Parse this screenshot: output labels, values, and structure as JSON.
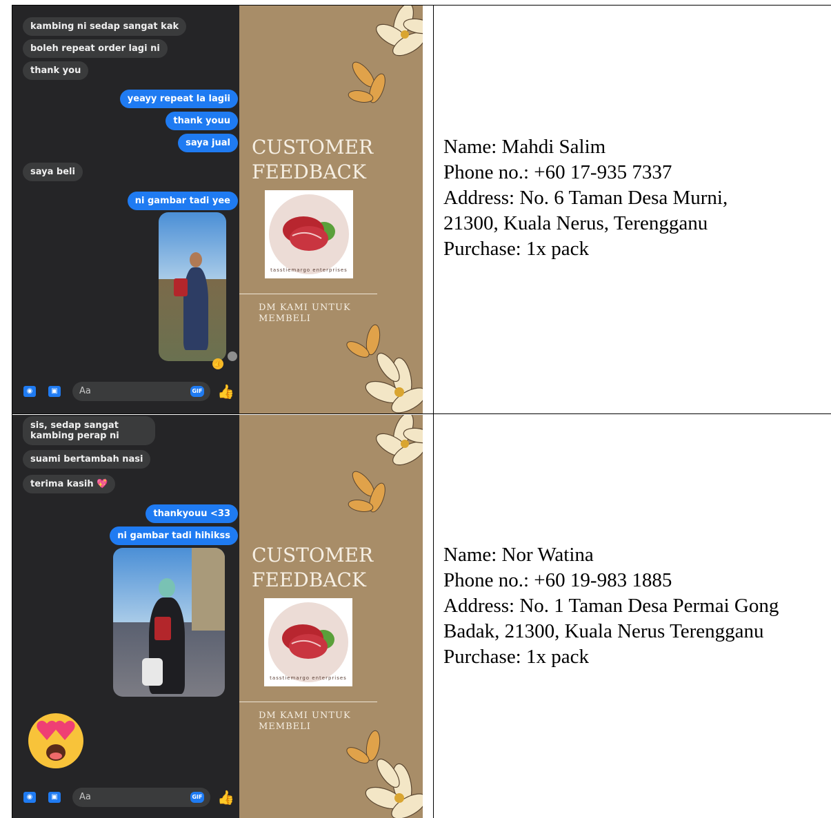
{
  "rows": [
    {
      "chat": {
        "incoming_1": "kambing ni sedap sangat kak",
        "incoming_2": "boleh repeat order lagi ni",
        "incoming_3": "thank you",
        "outgoing_1": "yeayy repeat la lagii",
        "outgoing_2": "thank youu",
        "outgoing_3": "saya jual",
        "incoming_4": "saya beli",
        "outgoing_4": "ni gambar tadi yee",
        "composer_placeholder": "Aa",
        "gif_label": "GIF"
      },
      "poster": {
        "title_line1": "CUSTOMER",
        "title_line2": "FEEDBACK",
        "logo_text": "tasstiemargo enterprises",
        "cta_line1": "DM KAMI UNTUK",
        "cta_line2": "MEMBELI"
      },
      "details": {
        "name": "Name: Mahdi Salim",
        "phone": "Phone no.: +60 17-935 7337",
        "address_line1": "Address: No. 6 Taman Desa Murni,",
        "address_line2": "21300, Kuala Nerus, Terengganu",
        "purchase": "Purchase: 1x pack"
      }
    },
    {
      "chat": {
        "incoming_1": "sis, sedap sangat kambing perap ni",
        "incoming_2": "suami bertambah nasi",
        "incoming_3": "terima kasih 💖",
        "outgoing_1": "thankyouu <33",
        "outgoing_2": "ni gambar tadi hihikss",
        "composer_placeholder": "Aa",
        "gif_label": "GIF"
      },
      "poster": {
        "title_line1": "CUSTOMER",
        "title_line2": "FEEDBACK",
        "logo_text": "tasstiemargo enterprises",
        "cta_line1": "DM KAMI UNTUK",
        "cta_line2": "MEMBELI"
      },
      "details": {
        "name": "Name: Nor Watina",
        "phone": "Phone no.: +60 19-983 1885",
        "address_line1": "Address: No. 1 Taman Desa Permai Gong",
        "address_line2": "Badak, 21300, Kuala Nerus Terengganu",
        "purchase": "Purchase: 1x pack"
      }
    }
  ],
  "colors": {
    "chat_bg": "#252527",
    "incoming_bubble": "#3a3b3c",
    "outgoing_bubble": "#1f7bf2",
    "poster_bg": "#a88d68",
    "poster_text": "#f6efe3"
  },
  "icons": [
    "camera-icon",
    "image-icon",
    "gif-icon",
    "thumbs-up-icon",
    "heart-eyes-emoji",
    "flower-decoration",
    "meat-logo"
  ]
}
